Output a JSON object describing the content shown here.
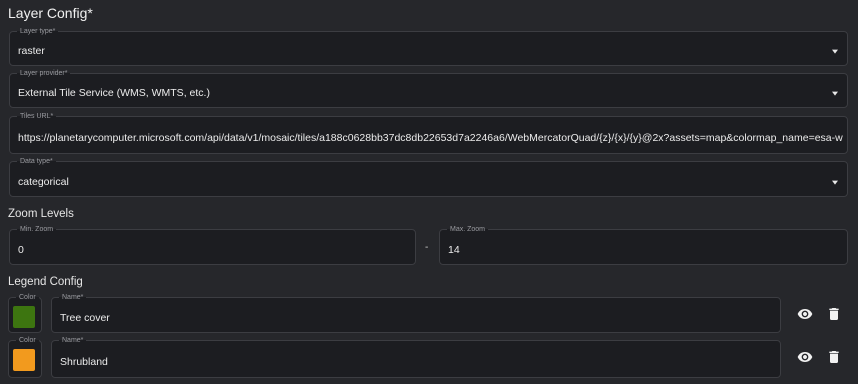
{
  "header": {
    "title": "Layer Config*"
  },
  "layer_type": {
    "label": "Layer type*",
    "value": "raster"
  },
  "layer_provider": {
    "label": "Layer provider*",
    "value": "External Tile Service (WMS, WMTS, etc.)"
  },
  "tiles_url": {
    "label": "Tiles URL*",
    "value": "https://planetarycomputer.microsoft.com/api/data/v1/mosaic/tiles/a188c0628bb37dc8db22653d7a2246a6/WebMercatorQuad/{z}/{x}/{y}@2x?assets=map&colormap_name=esa-worldcover&c"
  },
  "data_type": {
    "label": "Data type*",
    "value": "categorical"
  },
  "zoom": {
    "title": "Zoom Levels",
    "min": {
      "label": "Min. Zoom",
      "value": "0"
    },
    "separator": "-",
    "max": {
      "label": "Max. Zoom",
      "value": "14"
    }
  },
  "legend": {
    "title": "Legend Config",
    "items": [
      {
        "color_label": "Color",
        "color": "#3d7510",
        "name_label": "Name*",
        "name": "Tree cover"
      },
      {
        "color_label": "Color",
        "color": "#f29a1e",
        "name_label": "Name*",
        "name": "Shrubland"
      }
    ]
  },
  "icons": {
    "visibility": "eye-icon",
    "delete": "trash-icon",
    "dropdown": "caret-down-icon"
  }
}
